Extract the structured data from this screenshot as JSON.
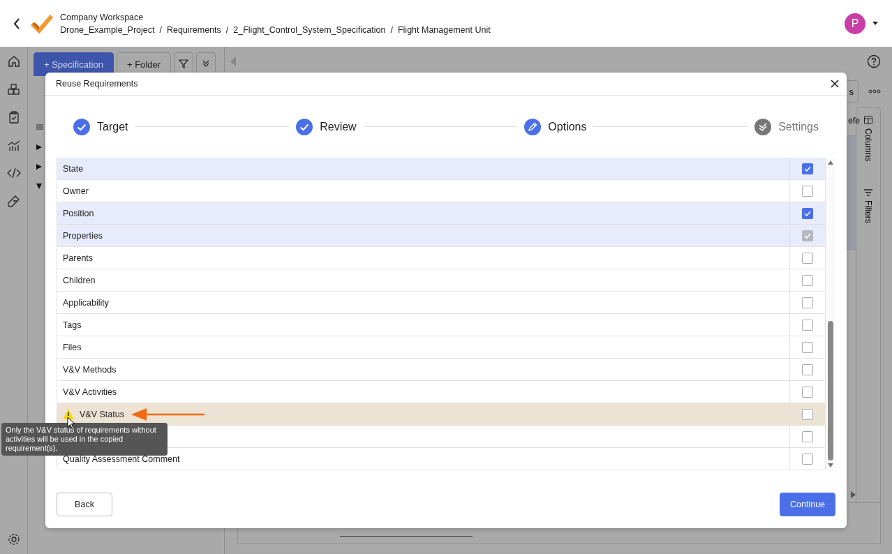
{
  "header": {
    "workspace": "Company Workspace",
    "breadcrumb": [
      "Drone_Example_Project",
      "Requirements",
      "2_Flight_Control_System_Specification",
      "Flight Management Unit"
    ],
    "separator": "/",
    "avatar": "P"
  },
  "background": {
    "toolbar": [
      {
        "label": "Specification",
        "kind": "primary"
      },
      {
        "label": "Folder",
        "kind": "plain"
      }
    ],
    "add_sign": "+",
    "partial_button": "s",
    "column_header": "efe",
    "side_tabs": [
      "Columns",
      "Filters"
    ]
  },
  "dialog": {
    "title": "Reuse Requirements",
    "steps": [
      {
        "label": "Target",
        "completed": true,
        "selected": false
      },
      {
        "label": "Review",
        "completed": true,
        "selected": false
      },
      {
        "label": "Options",
        "completed": false,
        "selected": true
      },
      {
        "label": "Settings",
        "completed": false,
        "selected": false
      }
    ],
    "rows": [
      {
        "label": "State",
        "checked": true,
        "disabled": false,
        "warning": false
      },
      {
        "label": "Owner",
        "checked": false,
        "disabled": false,
        "warning": false
      },
      {
        "label": "Position",
        "checked": true,
        "disabled": false,
        "warning": false
      },
      {
        "label": "Properties",
        "checked": true,
        "disabled": true,
        "warning": false
      },
      {
        "label": "Parents",
        "checked": false,
        "disabled": false,
        "warning": false
      },
      {
        "label": "Children",
        "checked": false,
        "disabled": false,
        "warning": false
      },
      {
        "label": "Applicability",
        "checked": false,
        "disabled": false,
        "warning": false
      },
      {
        "label": "Tags",
        "checked": false,
        "disabled": false,
        "warning": false
      },
      {
        "label": "Files",
        "checked": false,
        "disabled": false,
        "warning": false
      },
      {
        "label": "V&V Methods",
        "checked": false,
        "disabled": false,
        "warning": false
      },
      {
        "label": "V&V Activities",
        "checked": false,
        "disabled": false,
        "warning": false
      },
      {
        "label": "V&V Status",
        "checked": false,
        "disabled": false,
        "warning": true
      },
      {
        "checked": false,
        "disabled": false,
        "warning": false
      },
      {
        "label": "Quality Assessment Comment",
        "checked": false,
        "disabled": false,
        "warning": false
      }
    ],
    "tooltip": "Only the V&V status of requirements without activities will be used in the copied requirement(s).",
    "buttons": [
      {
        "label": "Back",
        "kind": "secondary"
      },
      {
        "label": "Continue",
        "kind": "primary"
      }
    ]
  }
}
